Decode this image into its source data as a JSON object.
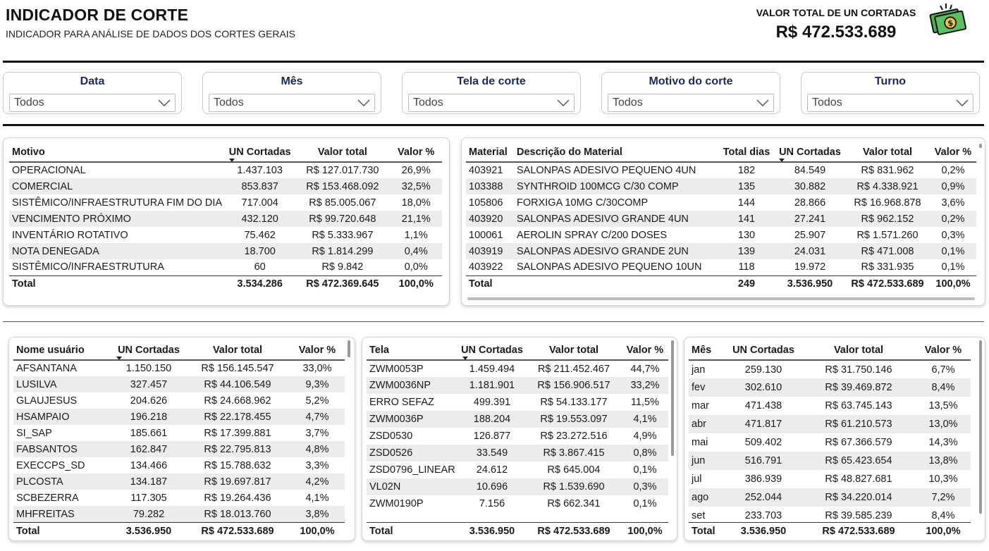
{
  "header": {
    "title": "INDICADOR DE CORTE",
    "subtitle": "INDICADOR PARA ANÁLISE DE DADOS DOS CORTES GERAIS",
    "kpi_label": "VALOR TOTAL DE UN CORTADAS",
    "kpi_value": "R$ 472.533.689",
    "kpi_icon": "money-icon"
  },
  "colors": {
    "slicer_title": "#1a2a5e",
    "stripe": "#ececec",
    "icon_green": "#4caf50"
  },
  "slicers": [
    {
      "title": "Data",
      "value": "Todos"
    },
    {
      "title": "Mês",
      "value": "Todos"
    },
    {
      "title": "Tela de corte",
      "value": "Todos"
    },
    {
      "title": "Motivo do corte",
      "value": "Todos"
    },
    {
      "title": "Turno",
      "value": "Todos"
    }
  ],
  "motivo_table": {
    "headers": [
      "Motivo",
      "UN Cortadas",
      "Valor total",
      "Valor %"
    ],
    "rows": [
      [
        "OPERACIONAL",
        "1.437.103",
        "R$ 127.017.730",
        "26,9%"
      ],
      [
        "COMERCIAL",
        "853.837",
        "R$ 153.468.092",
        "32,5%"
      ],
      [
        "SISTÊMICO/INFRAESTRUTURA FIM DO DIA",
        "717.004",
        "R$ 85.005.067",
        "18,0%"
      ],
      [
        "VENCIMENTO PRÓXIMO",
        "432.120",
        "R$ 99.720.648",
        "21,1%"
      ],
      [
        "INVENTÁRIO ROTATIVO",
        "75.462",
        "R$ 5.333.967",
        "1,1%"
      ],
      [
        "NOTA DENEGADA",
        "18.700",
        "R$ 1.814.299",
        "0,4%"
      ],
      [
        "SISTÊMICO/INFRAESTRUTURA",
        "60",
        "R$ 9.842",
        "0,0%"
      ]
    ],
    "total": [
      "Total",
      "3.534.286",
      "R$ 472.369.645",
      "100,0%"
    ]
  },
  "material_table": {
    "headers": [
      "Material",
      "Descrição do Material",
      "Total dias",
      "UN Cortadas",
      "Valor total",
      "Valor %"
    ],
    "rows": [
      [
        "403921",
        "SALONPAS ADESIVO PEQUENO 4UN",
        "182",
        "84.549",
        "R$ 831.962",
        "0,2%"
      ],
      [
        "103388",
        "SYNTHROID 100MCG C/30 COMP",
        "135",
        "30.882",
        "R$ 4.338.921",
        "0,9%"
      ],
      [
        "105806",
        "FORXIGA 10MG C/30COMP",
        "144",
        "28.866",
        "R$ 16.968.878",
        "3,6%"
      ],
      [
        "403920",
        "SALONPAS ADESIVO GRANDE 4UN",
        "141",
        "27.241",
        "R$ 962.152",
        "0,2%"
      ],
      [
        "100061",
        "AEROLIN SPRAY C/200 DOSES",
        "130",
        "25.907",
        "R$ 1.571.260",
        "0,3%"
      ],
      [
        "403919",
        "SALONPAS ADESIVO GRANDE 2UN",
        "139",
        "24.031",
        "R$ 471.008",
        "0,1%"
      ],
      [
        "403922",
        "SALONPAS ADESIVO PEQUENO 10UN",
        "118",
        "19.972",
        "R$ 331.935",
        "0,1%"
      ]
    ],
    "total": [
      "Total",
      "",
      "249",
      "3.536.950",
      "R$ 472.533.689",
      "100,0%"
    ]
  },
  "usuario_table": {
    "headers": [
      "Nome usuário",
      "UN Cortadas",
      "Valor total",
      "Valor %"
    ],
    "rows": [
      [
        "AFSANTANA",
        "1.150.150",
        "R$ 156.145.547",
        "33,0%"
      ],
      [
        "LUSILVA",
        "327.457",
        "R$ 44.106.549",
        "9,3%"
      ],
      [
        "GLAUJESUS",
        "204.626",
        "R$ 24.668.962",
        "5,2%"
      ],
      [
        "HSAMPAIO",
        "196.218",
        "R$ 22.178.455",
        "4,7%"
      ],
      [
        "SI_SAP",
        "185.661",
        "R$ 17.399.881",
        "3,7%"
      ],
      [
        "FABSANTOS",
        "162.847",
        "R$ 22.795.813",
        "4,8%"
      ],
      [
        "EXECCPS_SD",
        "134.466",
        "R$ 15.788.632",
        "3,3%"
      ],
      [
        "PLCOSTA",
        "134.187",
        "R$ 19.697.817",
        "4,2%"
      ],
      [
        "SCBEZERRA",
        "117.305",
        "R$ 19.264.436",
        "4,1%"
      ],
      [
        "MHFREITAS",
        "79.282",
        "R$ 18.013.760",
        "3,8%"
      ]
    ],
    "total": [
      "Total",
      "3.536.950",
      "R$ 472.533.689",
      "100,0%"
    ]
  },
  "tela_table": {
    "headers": [
      "Tela",
      "UN Cortadas",
      "Valor total",
      "Valor %"
    ],
    "rows": [
      [
        "ZWM0053P",
        "1.459.494",
        "R$ 211.452.467",
        "44,7%"
      ],
      [
        "ZWM0036NP",
        "1.181.901",
        "R$ 156.906.517",
        "33,2%"
      ],
      [
        "ERRO SEFAZ",
        "499.391",
        "R$ 54.133.177",
        "11,5%"
      ],
      [
        "ZWM0036P",
        "188.204",
        "R$ 19.553.097",
        "4,1%"
      ],
      [
        "ZSD0530",
        "126.877",
        "R$ 23.272.516",
        "4,9%"
      ],
      [
        "ZSD0526",
        "33.549",
        "R$ 3.867.415",
        "0,8%"
      ],
      [
        "ZSD0796_LINEAR",
        "24.612",
        "R$ 645.004",
        "0,1%"
      ],
      [
        "VL02N",
        "10.696",
        "R$ 1.539.690",
        "0,3%"
      ],
      [
        "ZWM0190P",
        "7.156",
        "R$ 662.341",
        "0,1%"
      ]
    ],
    "total": [
      "Total",
      "3.536.950",
      "R$ 472.533.689",
      "100,0%"
    ]
  },
  "mes_table": {
    "headers": [
      "Mês",
      "UN Cortadas",
      "Valor total",
      "Valor %"
    ],
    "rows": [
      [
        "jan",
        "259.130",
        "R$ 31.750.146",
        "6,7%"
      ],
      [
        "fev",
        "302.610",
        "R$ 39.469.872",
        "8,4%"
      ],
      [
        "mar",
        "471.438",
        "R$ 63.745.143",
        "13,5%"
      ],
      [
        "abr",
        "471.817",
        "R$ 61.210.573",
        "13,0%"
      ],
      [
        "mai",
        "509.402",
        "R$ 67.366.579",
        "14,3%"
      ],
      [
        "jun",
        "516.791",
        "R$ 65.423.654",
        "13,8%"
      ],
      [
        "jul",
        "386.939",
        "R$ 48.827.681",
        "10,3%"
      ],
      [
        "ago",
        "252.044",
        "R$ 34.220.014",
        "7,2%"
      ],
      [
        "set",
        "233.703",
        "R$ 39.585.239",
        "8,4%"
      ]
    ],
    "total": [
      "Total",
      "3.536.950",
      "R$ 472.533.689",
      "100,0%"
    ]
  }
}
